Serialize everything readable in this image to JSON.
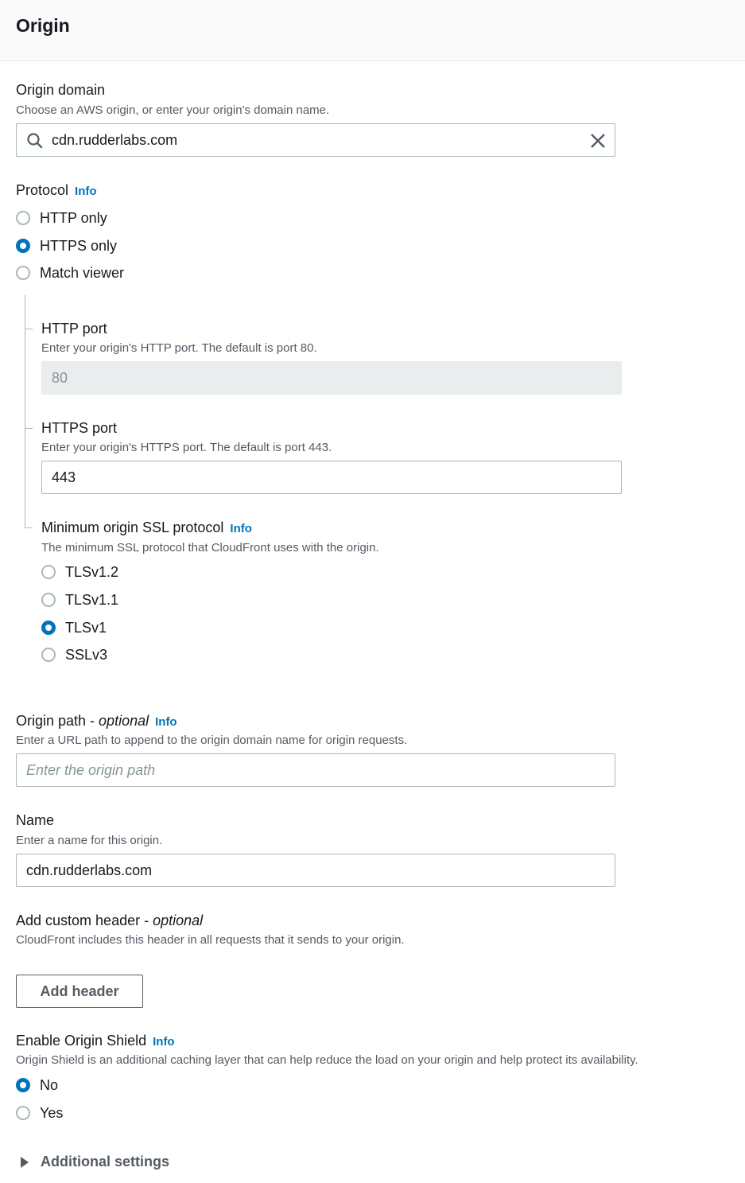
{
  "section": {
    "title": "Origin"
  },
  "origin_domain": {
    "label": "Origin domain",
    "description": "Choose an AWS origin, or enter your origin's domain name.",
    "value": "cdn.rudderlabs.com",
    "icons": {
      "search": "search-icon",
      "clear": "close-icon"
    }
  },
  "protocol": {
    "label": "Protocol",
    "info": "Info",
    "options": [
      {
        "label": "HTTP only",
        "checked": false
      },
      {
        "label": "HTTPS only",
        "checked": true
      },
      {
        "label": "Match viewer",
        "checked": false
      }
    ]
  },
  "http_port": {
    "label": "HTTP port",
    "description": "Enter your origin's HTTP port. The default is port 80.",
    "value": "80",
    "disabled": true
  },
  "https_port": {
    "label": "HTTPS port",
    "description": "Enter your origin's HTTPS port. The default is port 443.",
    "value": "443"
  },
  "ssl_protocol": {
    "label": "Minimum origin SSL protocol",
    "info": "Info",
    "description": "The minimum SSL protocol that CloudFront uses with the origin.",
    "options": [
      {
        "label": "TLSv1.2",
        "checked": false
      },
      {
        "label": "TLSv1.1",
        "checked": false
      },
      {
        "label": "TLSv1",
        "checked": true
      },
      {
        "label": "SSLv3",
        "checked": false
      }
    ]
  },
  "origin_path": {
    "label": "Origin path - ",
    "optional": "optional",
    "info": "Info",
    "description": "Enter a URL path to append to the origin domain name for origin requests.",
    "placeholder": "Enter the origin path",
    "value": ""
  },
  "name": {
    "label": "Name",
    "description": "Enter a name for this origin.",
    "value": "cdn.rudderlabs.com"
  },
  "custom_header": {
    "label": "Add custom header - ",
    "optional": "optional",
    "description": "CloudFront includes this header in all requests that it sends to your origin.",
    "button": "Add header"
  },
  "origin_shield": {
    "label": "Enable Origin Shield",
    "info": "Info",
    "description": "Origin Shield is an additional caching layer that can help reduce the load on your origin and help protect its availability.",
    "options": [
      {
        "label": "No",
        "checked": true
      },
      {
        "label": "Yes",
        "checked": false
      }
    ]
  },
  "additional_settings": {
    "label": "Additional settings",
    "expanded": false
  },
  "colors": {
    "accent": "#0073bb",
    "text": "#16191f",
    "secondary": "#545b64",
    "border": "#aab7b8",
    "disabled_bg": "#eaeded"
  }
}
